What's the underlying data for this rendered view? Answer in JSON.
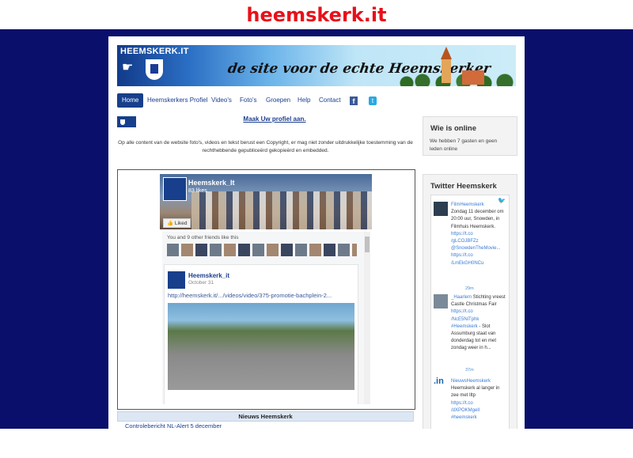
{
  "page_title": "heemskerk.it",
  "banner": {
    "logo_text": "HEEMSKERK.IT",
    "slogan": "de site voor de echte Heemskerker"
  },
  "nav": {
    "items": [
      "Home",
      "Heemskerkers Profiel",
      "Video's",
      "Foto's",
      "Groepen",
      "Help",
      "Contact"
    ],
    "facebook_icon": "f",
    "twitter_icon": "t"
  },
  "profile_link": "Maak Uw profiel aan.",
  "copyright": "Op alle content van de website foto's, videos en tekst berust een Copyright, er mag niet zonder uitdrukkelijke toestemming van de rechthebbende gepubliceërd gekopieërd en embedded.",
  "facebook": {
    "page_name": "Heemskerk_It",
    "likes": "83 likes",
    "liked_button": "Liked",
    "friends_text": "You and 9 other friends like this",
    "post": {
      "author": "Heemskerk_it",
      "date": "October 31",
      "link": "http://heemskerk.it/.../videos/video/375-promotie-bachplein-2..."
    }
  },
  "news": {
    "header": "Nieuws Heemskerk",
    "items": [
      "Controlebericht NL-Alert 5 december"
    ]
  },
  "who_online": {
    "title": "Wie is online",
    "text": "We hebben 7 gasten en geen leden online"
  },
  "twitter": {
    "title": "Twitter Heemskerk",
    "tweets": [
      {
        "user": "FilmHeemskerk",
        "text": "Zondag 11 december om 20:00 uur, Snowden, in Filmhuis Heemskerk.",
        "links": [
          "https://t.co",
          "/gLCOJBFZz",
          "@SnowdenTheMovie...",
          "https://t.co",
          "/LmEkGH0NCu"
        ],
        "time": "29m"
      },
      {
        "user": "_Haarlem",
        "text": "Stichting vreest Castle Christmas Fair",
        "links": [
          "https://t.co",
          "/NcE5NiTphk",
          "#Heemskerk"
        ],
        "text2": "- Slot Assumburg staat van donderdag tot en met zondag weer in h...",
        "time": "37m"
      },
      {
        "user": "NieuwsHeemskerk",
        "text": "Heemskerk al langer in zee met Iltp",
        "links": [
          "https://t.co",
          "/dXPOKMgell",
          "#heemskerk"
        ],
        "time": ""
      }
    ]
  }
}
